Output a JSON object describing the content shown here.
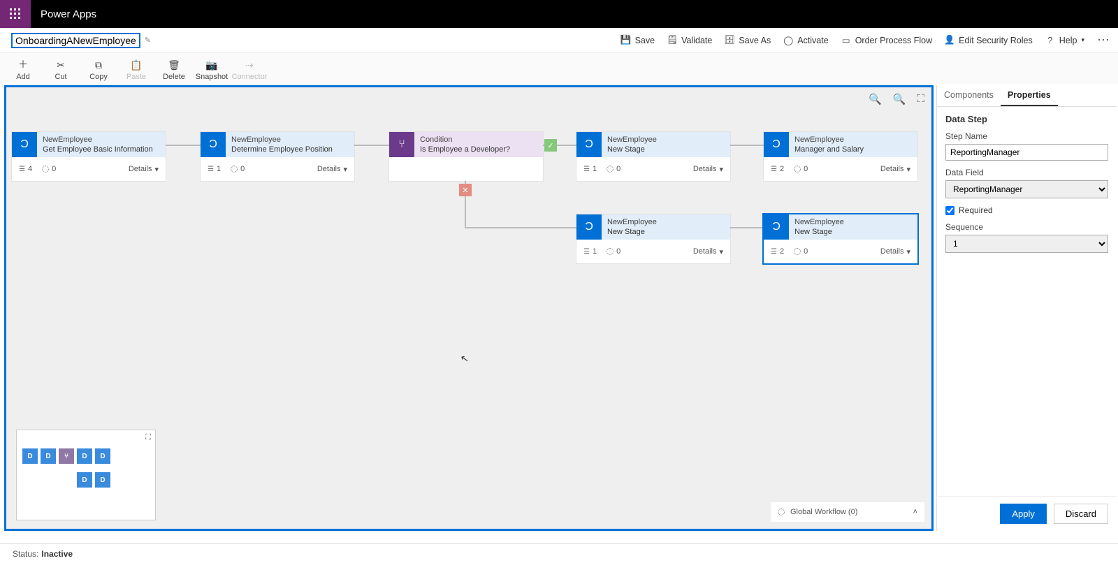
{
  "app": {
    "title": "Power Apps"
  },
  "header": {
    "flow_name": "OnboardingANewEmployee"
  },
  "cmds": {
    "save": "Save",
    "validate": "Validate",
    "saveas": "Save As",
    "activate": "Activate",
    "order": "Order Process Flow",
    "security": "Edit Security Roles",
    "help": "Help"
  },
  "tools": {
    "add": "Add",
    "cut": "Cut",
    "copy": "Copy",
    "paste": "Paste",
    "delete": "Delete",
    "snapshot": "Snapshot",
    "connector": "Connector"
  },
  "stages": {
    "s1": {
      "entity": "NewEmployee",
      "name": "Get Employee Basic Information",
      "steps": "4",
      "triggers": "0",
      "details": "Details"
    },
    "s2": {
      "entity": "NewEmployee",
      "name": "Determine Employee Position",
      "steps": "1",
      "triggers": "0",
      "details": "Details"
    },
    "cond": {
      "entity": "Condition",
      "name": "Is Employee a Developer?"
    },
    "s3": {
      "entity": "NewEmployee",
      "name": "New Stage",
      "steps": "1",
      "triggers": "0",
      "details": "Details"
    },
    "s4": {
      "entity": "NewEmployee",
      "name": "Manager and Salary",
      "steps": "2",
      "triggers": "0",
      "details": "Details"
    },
    "s5": {
      "entity": "NewEmployee",
      "name": "New Stage",
      "steps": "1",
      "triggers": "0",
      "details": "Details"
    },
    "s6": {
      "entity": "NewEmployee",
      "name": "New Stage",
      "steps": "2",
      "triggers": "0",
      "details": "Details"
    }
  },
  "globalwf": {
    "label": "Global Workflow (0)"
  },
  "panel": {
    "tab_components": "Components",
    "tab_properties": "Properties",
    "title": "Data Step",
    "step_name_label": "Step Name",
    "step_name_value": "ReportingManager",
    "data_field_label": "Data Field",
    "data_field_value": "ReportingManager",
    "required_label": "Required",
    "sequence_label": "Sequence",
    "sequence_value": "1",
    "apply": "Apply",
    "discard": "Discard"
  },
  "status": {
    "label": "Status:",
    "value": "Inactive"
  }
}
